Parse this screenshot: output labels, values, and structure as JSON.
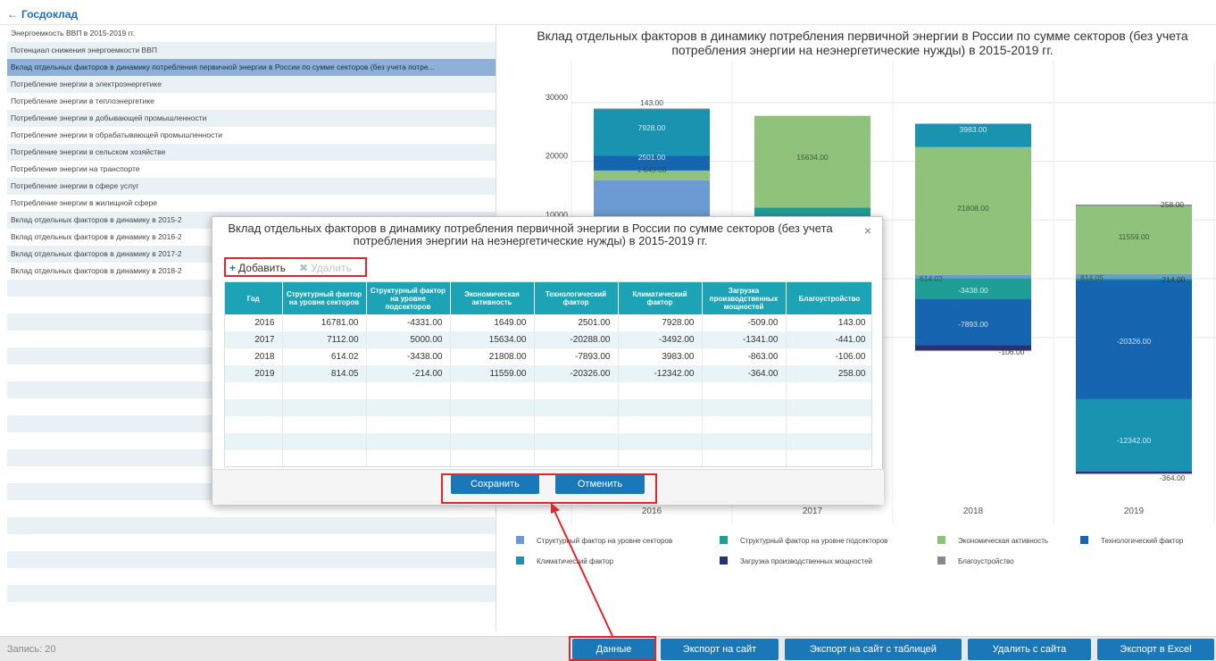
{
  "topbar": {
    "back_label": "Госдоклад"
  },
  "left_list": [
    "Энергоемкость ВВП в 2015-2019 гг.",
    "Потенциал снижения энергоемкости ВВП",
    "Вклад отдельных факторов в динамику потребления первичной энергии в России по сумме секторов (без учета потре...",
    "Потребление энергии в электроэнергетике",
    "Потребление энергии в теплоэнергетике",
    "Потребление энергии в добывающей промышленности",
    "Потребление энергии в обрабатывающей промышленности",
    "Потребление энергии в сельском хозяйстве",
    "Потребление энергии на транспорте",
    "Потребление энергии в сфере услуг",
    "Потребление энергии в жилищной сфере",
    "Вклад отдельных факторов в динамику в 2015-2",
    "Вклад отдельных факторов в динамику в 2016-2",
    "Вклад отдельных факторов в динамику в 2017-2",
    "Вклад отдельных факторов в динамику в 2018-2"
  ],
  "footer": {
    "record_count": "Запись: 20",
    "buttons": [
      "Данные",
      "Экспорт на сайт",
      "Экспорт на сайт с таблицей",
      "Удалить с сайта",
      "Экспорт в Excel"
    ]
  },
  "chart_data": {
    "type": "bar",
    "stacked": true,
    "title": "Вклад отдельных факторов в динамику потребления первичной энергии в России по сумме секторов (без учета потребления энергии на неэнергетические нужды) в 2015-2019 гг.",
    "categories": [
      "2016",
      "2017",
      "2018",
      "2019"
    ],
    "y_ticks": [
      "30000",
      "20000",
      "10000"
    ],
    "ylim": [
      -14000,
      33000
    ],
    "legend_position": "bottom",
    "series": [
      {
        "name": "Структурный фактор на уровне секторов",
        "color": "#6b9bd2",
        "values": [
          16781.0,
          7112.0,
          614.02,
          814.05
        ]
      },
      {
        "name": "Структурный фактор на уровне подсекторов",
        "color": "#1f9e96",
        "values": [
          -4331.0,
          5000.0,
          -3438.0,
          -214.0
        ]
      },
      {
        "name": "Экономическая активность",
        "color": "#8fc27a",
        "values": [
          1649.0,
          15634.0,
          21808.0,
          11559.0
        ]
      },
      {
        "name": "Технологический фактор",
        "color": "#1565b0",
        "values": [
          2501.0,
          -20288.0,
          -7893.0,
          -20326.0
        ]
      },
      {
        "name": "Климатический фактор",
        "color": "#1a93b0",
        "values": [
          7928.0,
          -3492.0,
          3983.0,
          -12342.0
        ]
      },
      {
        "name": "Загрузка производственных мощностей",
        "color": "#2a2f78",
        "values": [
          -509.0,
          -1341.0,
          -863.0,
          -364.0
        ]
      },
      {
        "name": "Благоустройство",
        "color": "#8a8a8a",
        "values": [
          143.0,
          -441.0,
          -106.0,
          258.0
        ]
      }
    ],
    "visible_labels": {
      "2016": [
        "143.00",
        "7928.00",
        "2501.00",
        "1 649.00",
        "16781.00"
      ],
      "2017": [
        "15634.00",
        "5000.00"
      ],
      "2018": [
        "3983.00",
        "21808.00",
        "614.02",
        "-3438.00",
        "-7893.00",
        "-106.00"
      ],
      "2019": [
        "258.00",
        "11559.00",
        "814.05",
        "-214.00",
        "-20326.00",
        "-12342.00",
        "-364.00"
      ]
    }
  },
  "modal": {
    "title": "Вклад отдельных факторов в динамику потребления первичной энергии в России по сумме секторов (без учета потребления энергии на неэнергетические нужды) в 2015-2019 гг.",
    "close": "×",
    "toolbar": {
      "add": "Добавить",
      "delete": "Удалить"
    },
    "columns": [
      "Год",
      "Структурный фактор на уровне секторов",
      "Структурный фактор на уровне подсекторов",
      "Экономическая активность",
      "Технологический фактор",
      "Климатический фактор",
      "Загрузка производственных мощностей",
      "Благоустройство"
    ],
    "rows": [
      [
        "2016",
        "16781.00",
        "-4331.00",
        "1649.00",
        "2501.00",
        "7928.00",
        "-509.00",
        "143.00"
      ],
      [
        "2017",
        "7112.00",
        "5000.00",
        "15634.00",
        "-20288.00",
        "-3492.00",
        "-1341.00",
        "-441.00"
      ],
      [
        "2018",
        "614.02",
        "-3438.00",
        "21808.00",
        "-7893.00",
        "3983.00",
        "-863.00",
        "-106.00"
      ],
      [
        "2019",
        "814.05",
        "-214.00",
        "11559.00",
        "-20326.00",
        "-12342.00",
        "-364.00",
        "258.00"
      ]
    ],
    "save": "Сохранить",
    "cancel": "Отменить"
  }
}
